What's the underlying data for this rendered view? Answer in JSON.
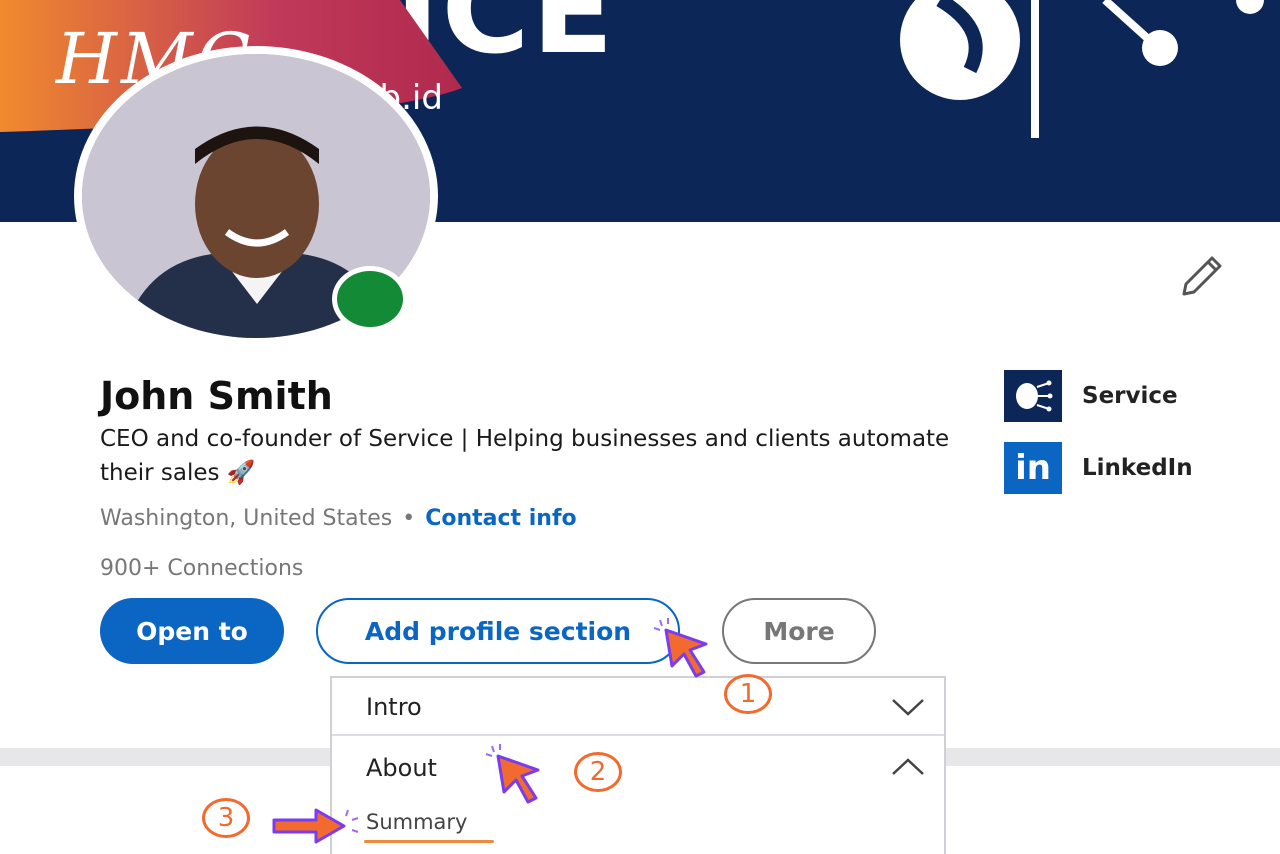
{
  "banner": {
    "word": "VICE"
  },
  "watermark": {
    "brand": "HMC",
    "domain": ".web.id"
  },
  "profile": {
    "name": "John Smith",
    "headline": "CEO and co-founder of Service | Helping businesses and clients automate their sales 🚀",
    "location": "Washington, United States",
    "separator": "•",
    "contact_label": "Contact info",
    "connections": "900+ Connections"
  },
  "side_links": [
    {
      "label": "Service",
      "icon": "service-logo-icon"
    },
    {
      "label": "LinkedIn",
      "icon": "linkedin-logo-icon",
      "glyph": "in"
    }
  ],
  "actions": {
    "open_to": "Open to",
    "add_section": "Add profile section",
    "more": "More"
  },
  "dropdown": {
    "items": [
      {
        "label": "Intro",
        "state": "collapsed"
      },
      {
        "label": "About",
        "state": "expanded"
      }
    ],
    "sub_item": "Summary"
  },
  "steps": [
    "1",
    "2",
    "3"
  ],
  "colors": {
    "banner": "#0c2657",
    "primary": "#0a66c2",
    "online": "#138a36",
    "annotation": "#f26a2e",
    "cursor": "#f26a2e"
  }
}
